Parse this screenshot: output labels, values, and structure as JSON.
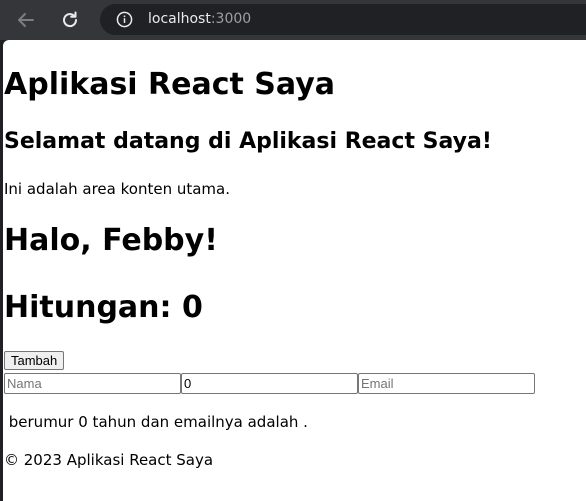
{
  "browser": {
    "url_host": "localhost",
    "url_port": ":3000",
    "icons": [
      "back-arrow-icon",
      "reload-icon",
      "info-icon"
    ]
  },
  "header": {
    "title": "Aplikasi React Saya"
  },
  "main": {
    "welcome": "Selamat datang di Aplikasi React Saya!",
    "intro": "Ini adalah area konten utama."
  },
  "greeting": {
    "text": "Halo, Febby!"
  },
  "counter": {
    "label": "Hitungan: ",
    "value": "0",
    "button_label": "Tambah"
  },
  "form": {
    "name_placeholder": "Nama",
    "name_value": "",
    "age_value": "0",
    "email_placeholder": "Email",
    "email_value": ""
  },
  "summary": {
    "text": " berumur 0 tahun dan emailnya adalah ."
  },
  "footer": {
    "text": "© 2023 Aplikasi React Saya"
  }
}
